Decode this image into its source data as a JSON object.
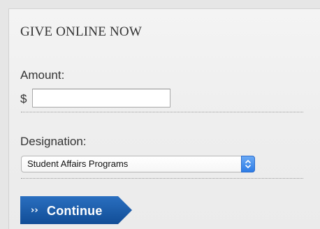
{
  "form": {
    "title": "GIVE ONLINE NOW",
    "amount_label": "Amount:",
    "currency_symbol": "$",
    "amount_value": "",
    "divider": "",
    "designation_label": "Designation:",
    "designation_selected": "Student Affairs Programs",
    "continue_label": "Continue",
    "continue_icon": "double-chevron-right-icon",
    "select_icon": "select-updown-arrows-icon"
  },
  "colors": {
    "panel_bg": "#eeeeee",
    "button_blue": "#1a5aa6",
    "select_arrow_blue": "#2d7ce6",
    "text": "#333333"
  }
}
